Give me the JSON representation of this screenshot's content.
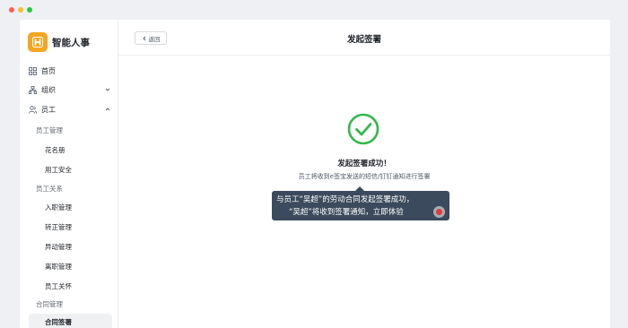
{
  "window": {
    "controls": [
      "close",
      "minimize",
      "maximize"
    ]
  },
  "brand": {
    "logo_letter": "H",
    "name": "智能人事",
    "logo_color": "#f5a623"
  },
  "sidebar": {
    "home": {
      "label": "首页",
      "icon": "grid-icon"
    },
    "org": {
      "label": "组织",
      "icon": "org-chart-icon",
      "expanded": false
    },
    "employee": {
      "label": "员工",
      "icon": "user-group-icon",
      "expanded": true
    },
    "groups": [
      {
        "label": "员工管理",
        "items": [
          "花名册",
          "用工安全"
        ]
      },
      {
        "label": "员工关系",
        "items": [
          "入职管理",
          "转正管理",
          "异动管理",
          "离职管理",
          "员工关怀"
        ]
      },
      {
        "label": "合同管理",
        "items": [
          "合同签署"
        ]
      }
    ],
    "active_item": "合同签署"
  },
  "header": {
    "back_label": "返回",
    "title": "发起签署"
  },
  "result": {
    "status": "success",
    "icon": "check-circle-icon",
    "title": "发起签署成功！",
    "description": "员工将收到e签宝发送的短信/钉钉通知进行签署",
    "success_color": "#34b84a"
  },
  "tooltip": {
    "line1": "与员工“吴超”的劳动合同发起签署成功，",
    "line2": "“吴超”将收到签署通知，立即体验",
    "background": "#3b4a5c"
  }
}
